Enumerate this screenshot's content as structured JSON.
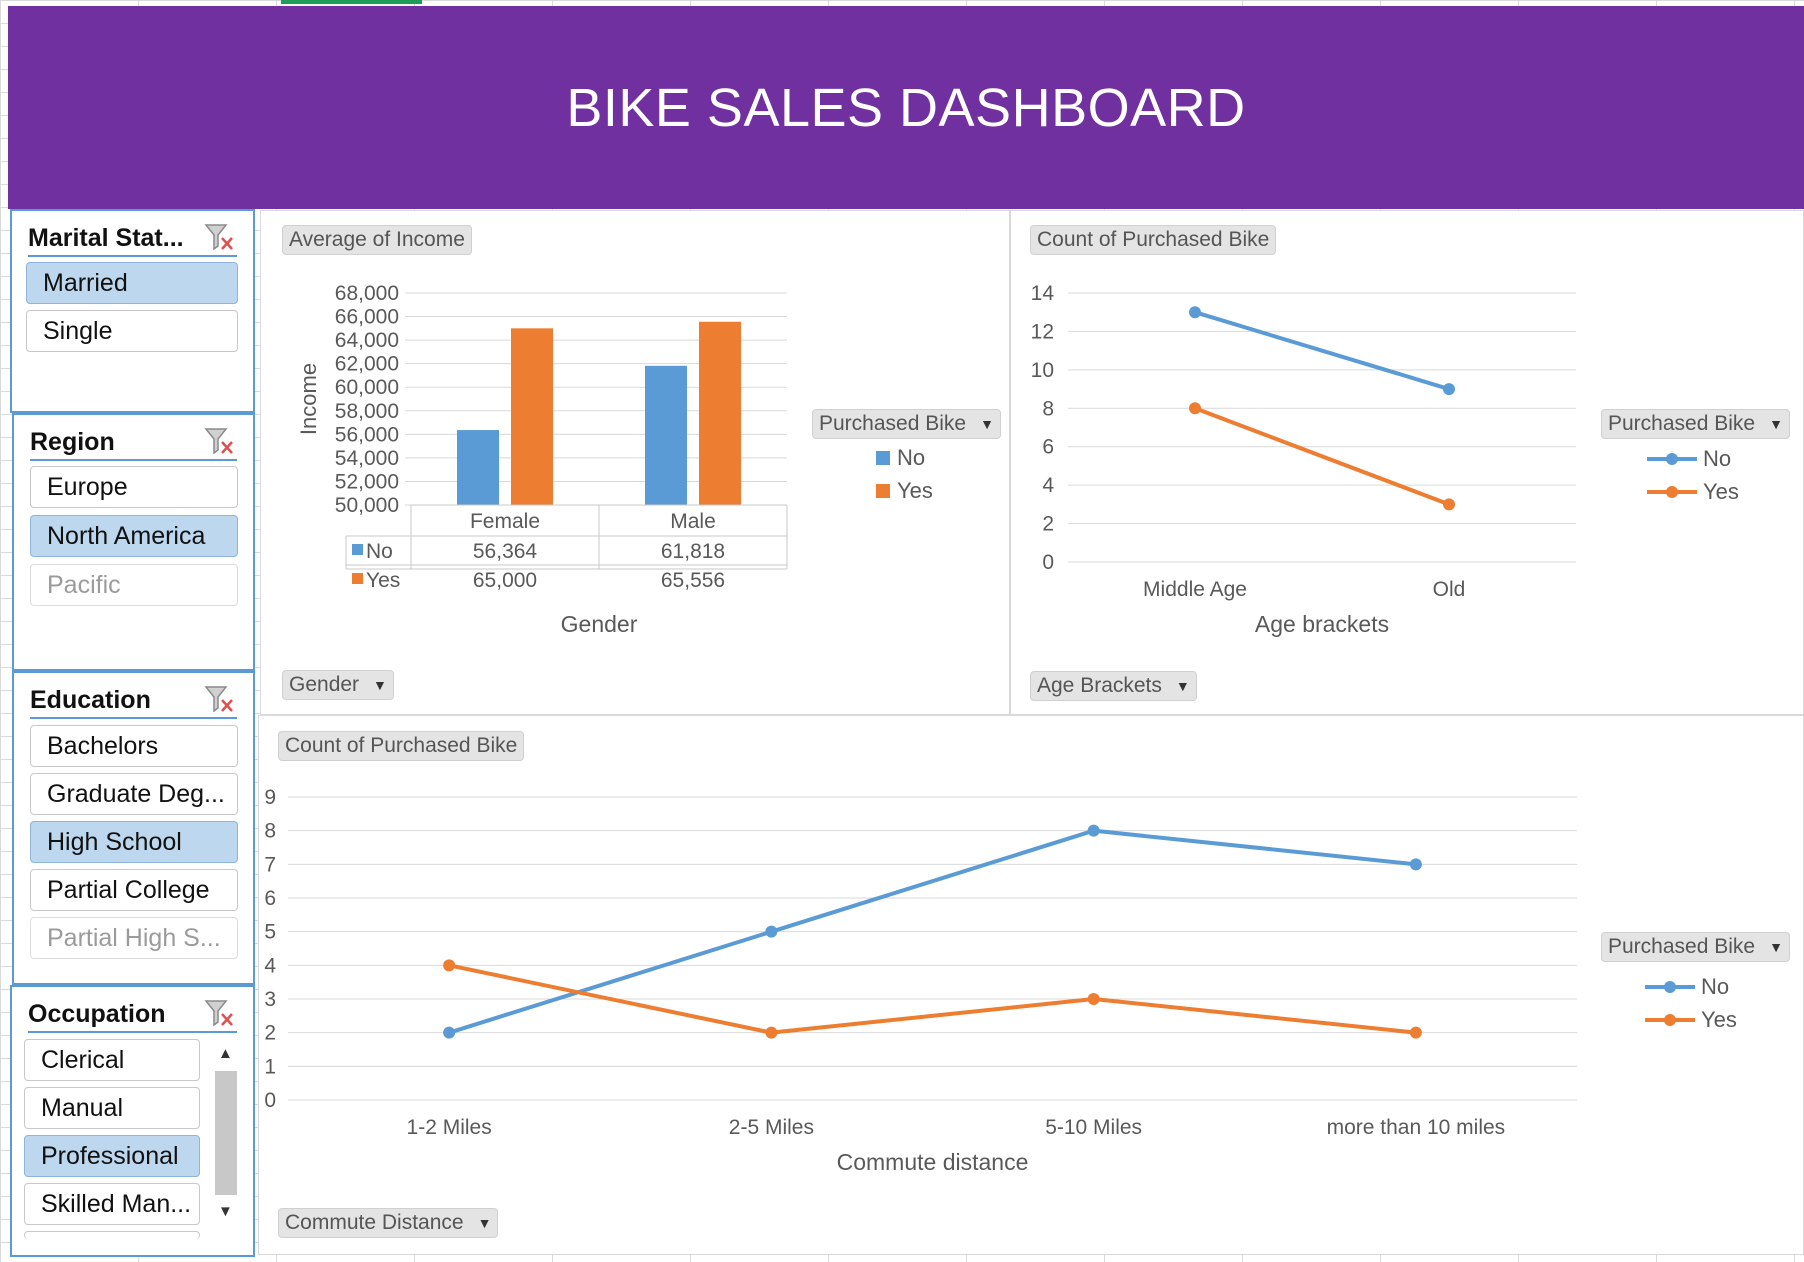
{
  "title": "BIKE SALES DASHBOARD",
  "colors": {
    "header": "#7030a0",
    "no": "#5b9bd5",
    "yes": "#ed7d31",
    "slicer_selected": "#bdd7ee",
    "slicer_border": "#5b9bd5"
  },
  "slicers": {
    "marital": {
      "title": "Marital Stat...",
      "items": [
        {
          "label": "Married",
          "state": "selected"
        },
        {
          "label": "Single",
          "state": "normal"
        }
      ]
    },
    "region": {
      "title": "Region",
      "items": [
        {
          "label": "Europe",
          "state": "normal"
        },
        {
          "label": "North America",
          "state": "selected"
        },
        {
          "label": "Pacific",
          "state": "dimmed"
        }
      ]
    },
    "education": {
      "title": "Education",
      "items": [
        {
          "label": "Bachelors",
          "state": "normal"
        },
        {
          "label": "Graduate Deg...",
          "state": "normal"
        },
        {
          "label": "High School",
          "state": "selected"
        },
        {
          "label": "Partial College",
          "state": "normal"
        },
        {
          "label": "Partial High S...",
          "state": "dimmed"
        }
      ]
    },
    "occupation": {
      "title": "Occupation",
      "items": [
        {
          "label": "Clerical",
          "state": "normal"
        },
        {
          "label": "Manual",
          "state": "normal"
        },
        {
          "label": "Professional",
          "state": "selected"
        },
        {
          "label": "Skilled Man...",
          "state": "normal"
        }
      ]
    }
  },
  "charts": {
    "income": {
      "value_button": "Average of Income",
      "axis_button": "Gender",
      "legend_button": "Purchased Bike"
    },
    "age": {
      "value_button": "Count of Purchased Bike",
      "axis_button": "Age Brackets",
      "legend_button": "Purchased Bike"
    },
    "commute": {
      "value_button": "Count of Purchased Bike",
      "axis_button": "Commute Distance",
      "legend_button": "Purchased Bike"
    }
  },
  "chart_data": [
    {
      "type": "bar",
      "categories": [
        "Female",
        "Male"
      ],
      "series": [
        {
          "name": "No",
          "values": [
            56364,
            61818
          ],
          "labels": [
            "56,364",
            "61,818"
          ]
        },
        {
          "name": "Yes",
          "values": [
            65000,
            65556
          ],
          "labels": [
            "65,000",
            "65,556"
          ]
        }
      ],
      "xlabel": "Gender",
      "ylabel": "Income",
      "ylim": [
        50000,
        68000
      ],
      "yticks": [
        "50,000",
        "52,000",
        "54,000",
        "56,000",
        "58,000",
        "60,000",
        "62,000",
        "64,000",
        "66,000",
        "68,000"
      ],
      "data_table": true,
      "legend": "right"
    },
    {
      "type": "line",
      "categories": [
        "Middle Age",
        "Old"
      ],
      "series": [
        {
          "name": "No",
          "values": [
            13,
            9
          ]
        },
        {
          "name": "Yes",
          "values": [
            8,
            3
          ]
        }
      ],
      "xlabel": "Age brackets",
      "ylim": [
        0,
        14
      ],
      "yticks": [
        "0",
        "2",
        "4",
        "6",
        "8",
        "10",
        "12",
        "14"
      ],
      "legend": "right"
    },
    {
      "type": "line",
      "categories": [
        "1-2 Miles",
        "2-5 Miles",
        "5-10 Miles",
        "more than 10 miles"
      ],
      "series": [
        {
          "name": "No",
          "values": [
            2,
            5,
            8,
            7
          ]
        },
        {
          "name": "Yes",
          "values": [
            4,
            2,
            3,
            2
          ]
        }
      ],
      "xlabel": "Commute distance",
      "ylim": [
        0,
        9
      ],
      "yticks": [
        "0",
        "1",
        "2",
        "3",
        "4",
        "5",
        "6",
        "7",
        "8",
        "9"
      ],
      "legend": "right"
    }
  ]
}
